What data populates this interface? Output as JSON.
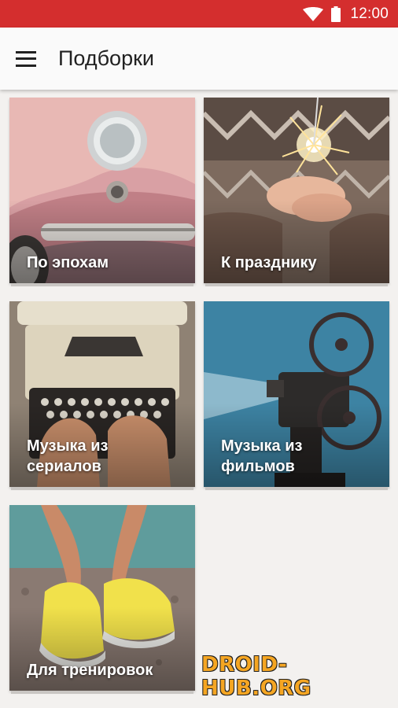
{
  "status_bar": {
    "time": "12:00",
    "icons": [
      "wifi-icon",
      "battery-icon"
    ],
    "color": "#d42e2e"
  },
  "app_bar": {
    "menu_icon": "menu-icon",
    "title": "Подборки"
  },
  "collections": [
    {
      "id": "eras",
      "label": "По эпохам"
    },
    {
      "id": "holiday",
      "label": "К празднику"
    },
    {
      "id": "series",
      "label": "Музыка из сериалов"
    },
    {
      "id": "films",
      "label": "Музыка из фильмов"
    },
    {
      "id": "workout",
      "label": "Для тренировок"
    }
  ],
  "watermark": "DROID-HUB.ORG"
}
